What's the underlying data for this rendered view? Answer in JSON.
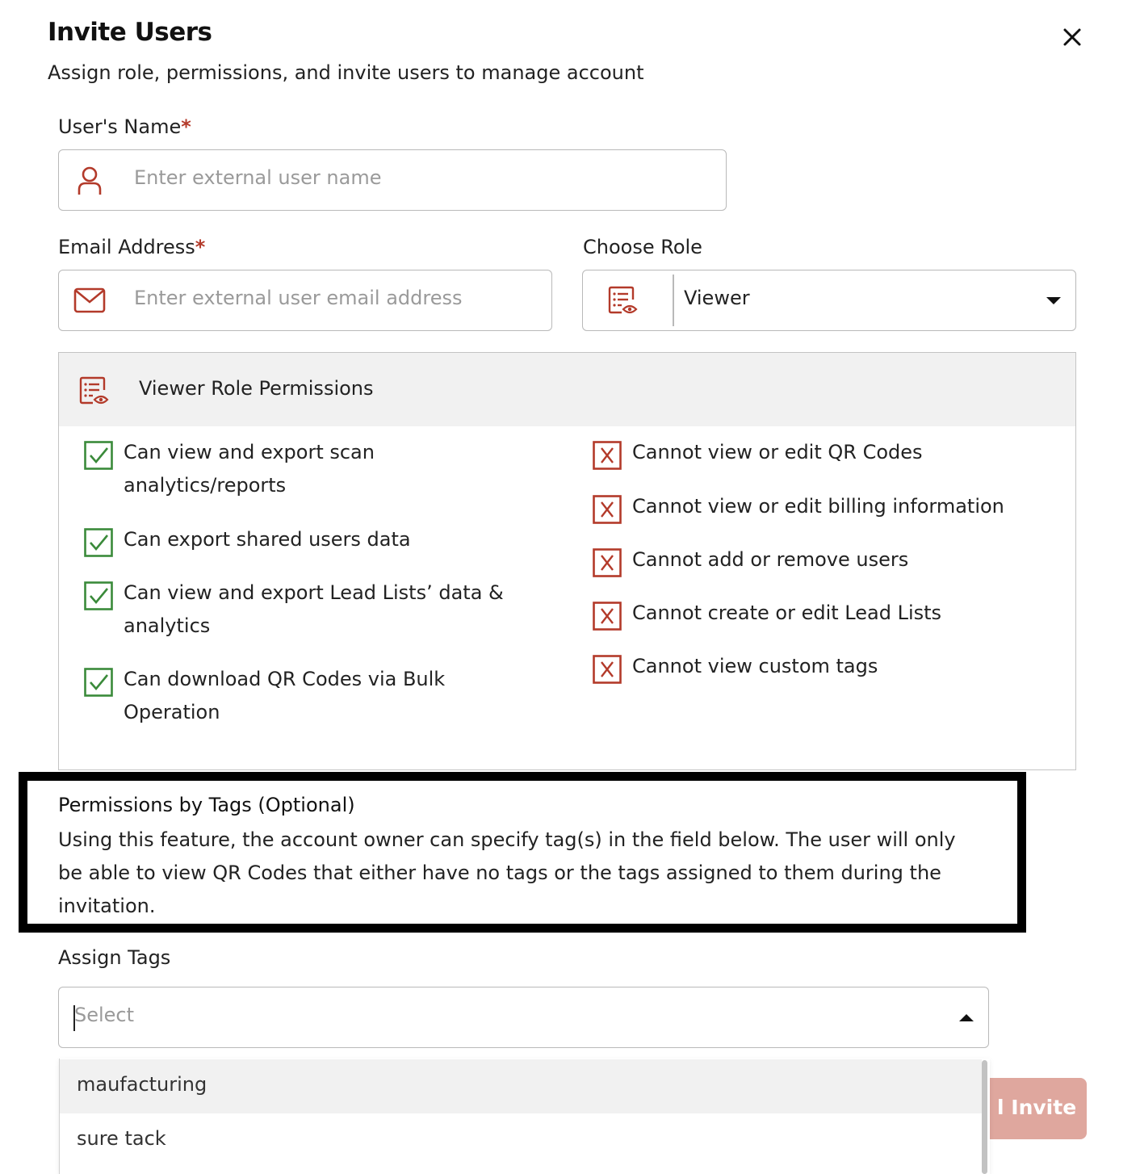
{
  "dialog": {
    "title": "Invite Users",
    "subtitle": "Assign role, permissions, and invite users to manage account",
    "close_icon": "close-icon"
  },
  "name_field": {
    "label": "User's Name",
    "required_mark": "*",
    "placeholder": "Enter external user name",
    "icon": "user-icon"
  },
  "email_field": {
    "label": "Email Address",
    "required_mark": "*",
    "placeholder": "Enter external user email address",
    "icon": "mail-icon"
  },
  "role_field": {
    "label": "Choose Role",
    "value": "Viewer",
    "icon": "role-list-eye-icon"
  },
  "permissions": {
    "title": "Viewer Role Permissions",
    "allowed": [
      {
        "line1": "Can view and export scan",
        "line2": "analytics/reports"
      },
      {
        "line1": "Can export shared users data",
        "line2": ""
      },
      {
        "line1": "Can view and export Lead Lists’ data &",
        "line2": "analytics"
      },
      {
        "line1": "Can download QR Codes via Bulk",
        "line2": "Operation"
      }
    ],
    "denied": [
      "Cannot view or edit QR Codes",
      "Cannot view or edit billing information",
      "Cannot add or remove users",
      "Cannot create or edit Lead Lists",
      "Cannot view custom tags"
    ]
  },
  "tags_section": {
    "title": "Permissions by Tags (Optional)",
    "description_lines": [
      "Using this feature, the account owner can specify tag(s) in the field below. The user will only",
      "be able to view QR Codes that either have no tags or the tags assigned to them during the",
      "invitation."
    ],
    "assign_label": "Assign Tags",
    "select_placeholder": "Select",
    "options": [
      "maufacturing",
      "sure tack"
    ]
  },
  "actions": {
    "invite_label": "l Invite"
  },
  "colors": {
    "accent_red": "#b33a2a",
    "check_green": "#3a8a3a",
    "invite_button": "#dfa79e"
  }
}
